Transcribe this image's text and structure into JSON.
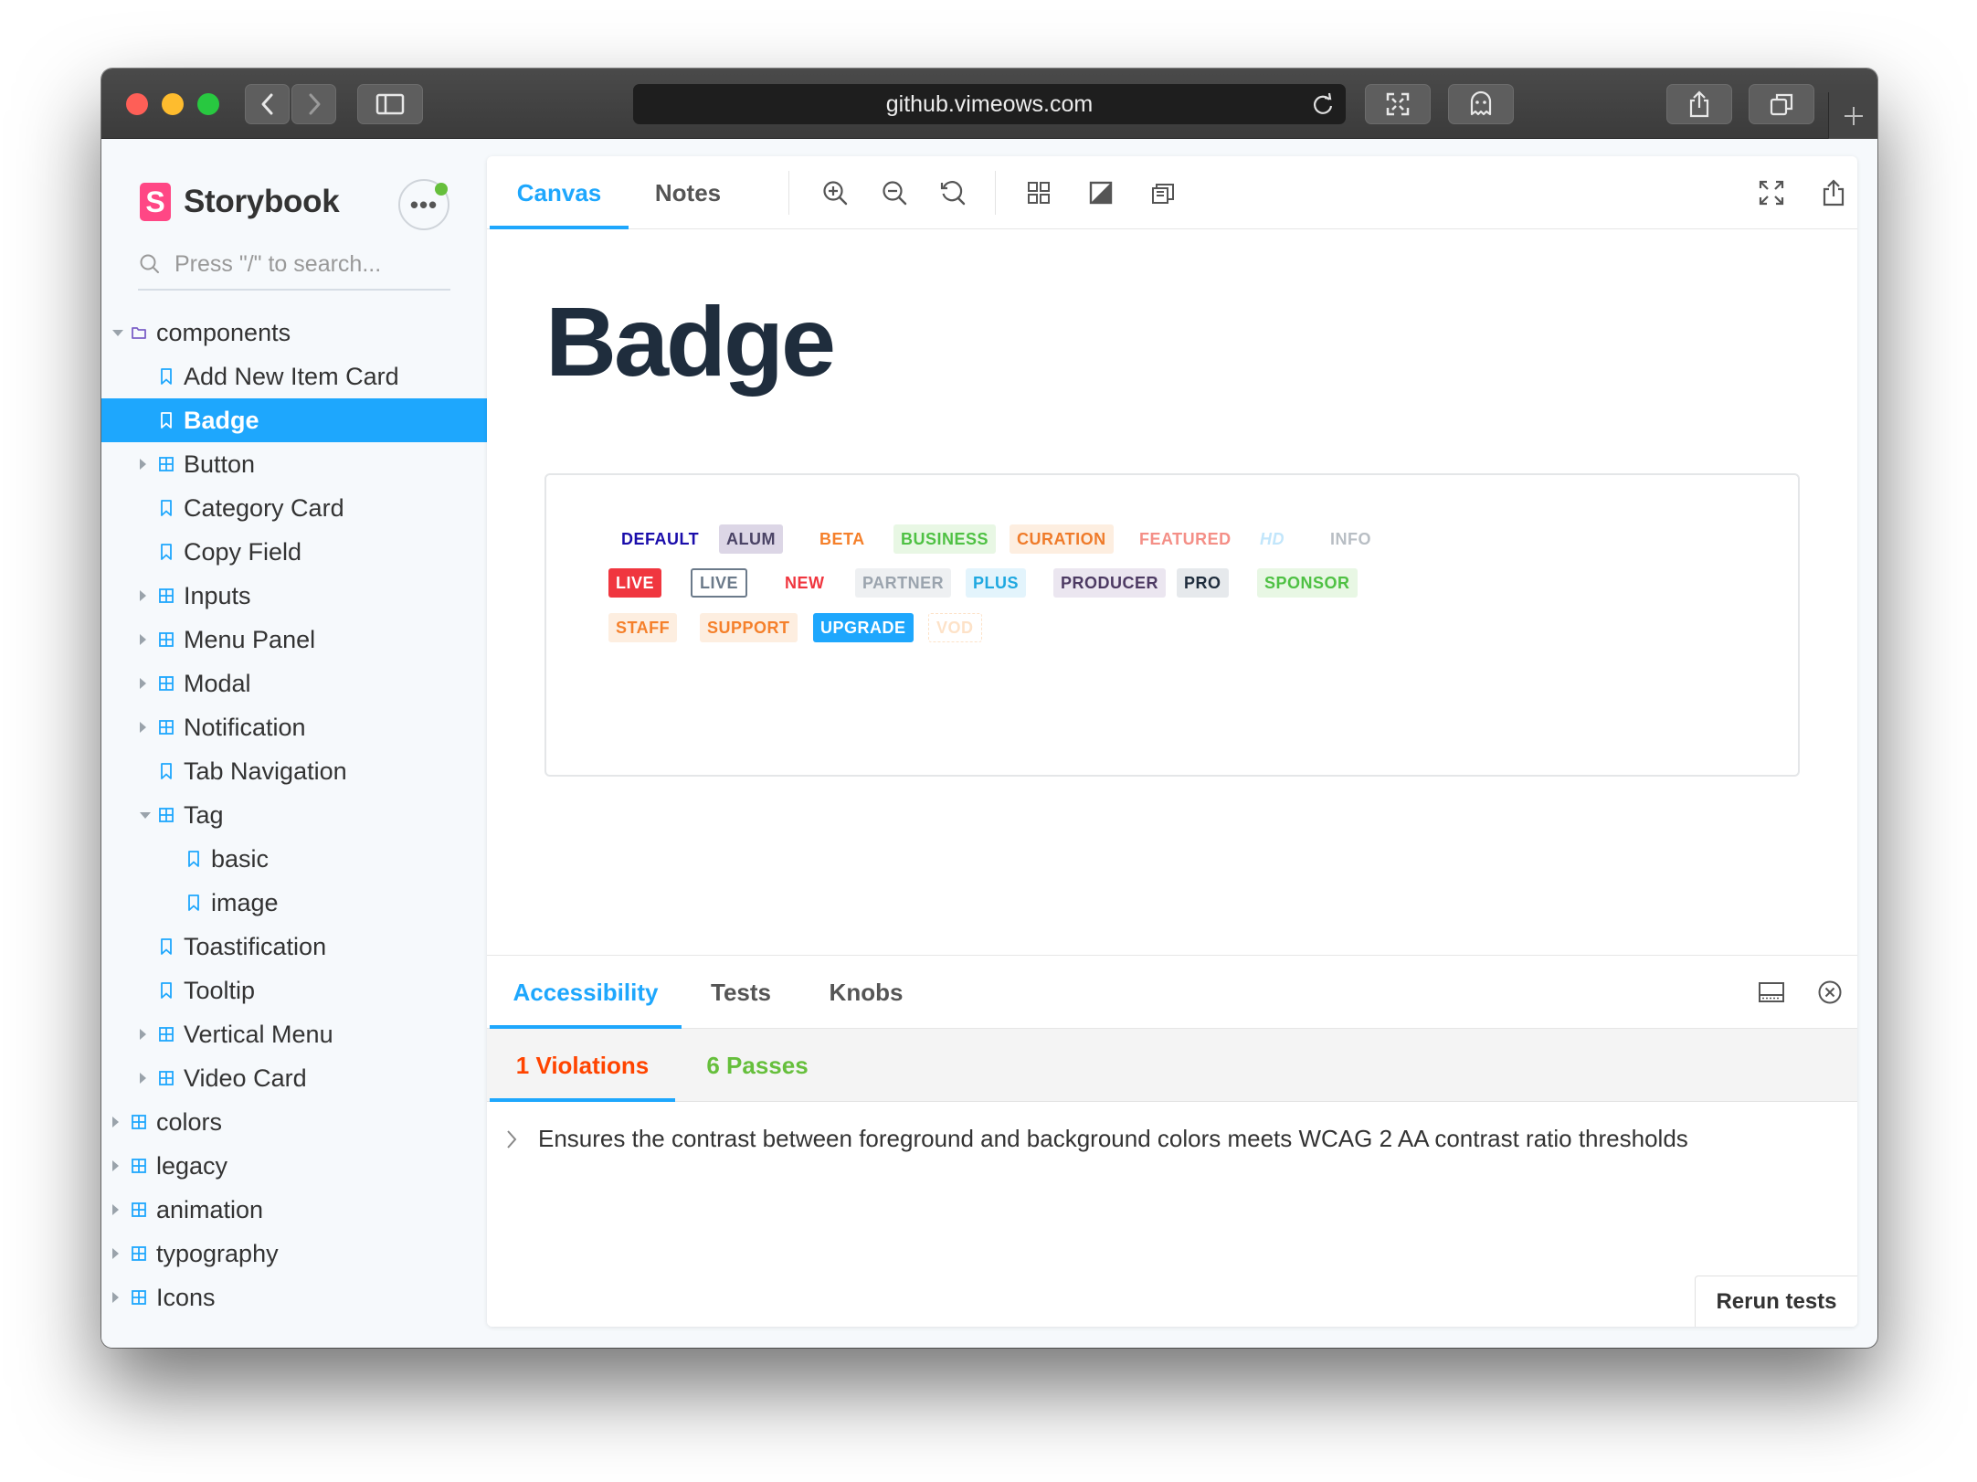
{
  "browser": {
    "url": "github.vimeows.com"
  },
  "sidebar": {
    "brand": "Storybook",
    "more_label": "•••",
    "search_placeholder": "Press \"/\" to search...",
    "tree": [
      {
        "label": "components",
        "icon": "folder-icon",
        "caret": "down",
        "level": 0
      },
      {
        "label": "Add New Item Card",
        "icon": "bookmark-icon",
        "caret": "none",
        "level": 1
      },
      {
        "label": "Badge",
        "icon": "bookmark-icon",
        "caret": "none",
        "level": 1,
        "selected": true
      },
      {
        "label": "Button",
        "icon": "grid-icon",
        "caret": "right",
        "level": 1
      },
      {
        "label": "Category Card",
        "icon": "bookmark-icon",
        "caret": "none",
        "level": 1
      },
      {
        "label": "Copy Field",
        "icon": "bookmark-icon",
        "caret": "none",
        "level": 1
      },
      {
        "label": "Inputs",
        "icon": "grid-icon",
        "caret": "right",
        "level": 1
      },
      {
        "label": "Menu Panel",
        "icon": "grid-icon",
        "caret": "right",
        "level": 1
      },
      {
        "label": "Modal",
        "icon": "grid-icon",
        "caret": "right",
        "level": 1
      },
      {
        "label": "Notification",
        "icon": "grid-icon",
        "caret": "right",
        "level": 1
      },
      {
        "label": "Tab Navigation",
        "icon": "bookmark-icon",
        "caret": "none",
        "level": 1
      },
      {
        "label": "Tag",
        "icon": "grid-icon",
        "caret": "down",
        "level": 1
      },
      {
        "label": "basic",
        "icon": "bookmark-icon",
        "caret": "none",
        "level": 2
      },
      {
        "label": "image",
        "icon": "bookmark-icon",
        "caret": "none",
        "level": 2
      },
      {
        "label": "Toastification",
        "icon": "bookmark-icon",
        "caret": "none",
        "level": 1
      },
      {
        "label": "Tooltip",
        "icon": "bookmark-icon",
        "caret": "none",
        "level": 1
      },
      {
        "label": "Vertical Menu",
        "icon": "grid-icon",
        "caret": "right",
        "level": 1
      },
      {
        "label": "Video Card",
        "icon": "grid-icon",
        "caret": "right",
        "level": 1
      },
      {
        "label": "colors",
        "icon": "grid-icon",
        "caret": "right",
        "level": 0
      },
      {
        "label": "legacy",
        "icon": "grid-icon",
        "caret": "right",
        "level": 0
      },
      {
        "label": "animation",
        "icon": "grid-icon",
        "caret": "right",
        "level": 0
      },
      {
        "label": "typography",
        "icon": "grid-icon",
        "caret": "right",
        "level": 0
      },
      {
        "label": "Icons",
        "icon": "grid-icon",
        "caret": "right",
        "level": 0
      }
    ]
  },
  "toolbar": {
    "tabs": [
      "Canvas",
      "Notes"
    ],
    "active_tab": "Canvas",
    "tools": [
      "zoom-in-icon",
      "zoom-out-icon",
      "zoom-reset-icon",
      "grid-icon",
      "background-icon",
      "viewport-icon"
    ],
    "right_tools": [
      "fullscreen-icon",
      "share-icon"
    ]
  },
  "canvas": {
    "title": "Badge",
    "badges": [
      {
        "text": "DEFAULT",
        "color": "#1a0dab",
        "bg": "transparent",
        "border": "none",
        "row": 0,
        "col": 0,
        "italic": false
      },
      {
        "text": "ALUM",
        "color": "#4b4466",
        "bg": "#dcd6e6",
        "border": "none",
        "row": 0,
        "col": 1,
        "italic": false
      },
      {
        "text": "BETA",
        "color": "#f5802b",
        "bg": "transparent",
        "border": "none",
        "row": 0,
        "col": 2,
        "italic": false
      },
      {
        "text": "BUSINESS",
        "color": "#4fc144",
        "bg": "#e8f7e4",
        "border": "none",
        "row": 0,
        "col": 3,
        "italic": false
      },
      {
        "text": "CURATION",
        "color": "#ef7b2a",
        "bg": "#fdeee0",
        "border": "none",
        "row": 0,
        "col": 4,
        "italic": false
      },
      {
        "text": "FEATURED",
        "color": "#f48f87",
        "bg": "transparent",
        "border": "none",
        "row": 0,
        "col": 5,
        "italic": false
      },
      {
        "text": "HD",
        "color": "#c2e6fb",
        "bg": "transparent",
        "border": "none",
        "row": 0,
        "col": 6,
        "italic": true
      },
      {
        "text": "INFO",
        "color": "#b8bec4",
        "bg": "transparent",
        "border": "none",
        "row": 0,
        "col": 7,
        "italic": false
      },
      {
        "text": "LIVE",
        "color": "#ffffff",
        "bg": "#f0363f",
        "border": "none",
        "row": 1,
        "col": 0,
        "italic": false
      },
      {
        "text": "LIVE",
        "color": "#6b7a8a",
        "bg": "#ffffff",
        "border": "2px solid #6b7a8a",
        "row": 1,
        "col": 1,
        "italic": false
      },
      {
        "text": "NEW",
        "color": "#f0363f",
        "bg": "transparent",
        "border": "none",
        "row": 1,
        "col": 2,
        "italic": false
      },
      {
        "text": "PARTNER",
        "color": "#9ba4ae",
        "bg": "#eef0f2",
        "border": "none",
        "row": 1,
        "col": 3,
        "italic": false
      },
      {
        "text": "PLUS",
        "color": "#1fa8e0",
        "bg": "#e3f4fc",
        "border": "none",
        "row": 1,
        "col": 4,
        "italic": false
      },
      {
        "text": "PRODUCER",
        "color": "#4d3a63",
        "bg": "#ebe6f0",
        "border": "none",
        "row": 1,
        "col": 5,
        "italic": false
      },
      {
        "text": "PRO",
        "color": "#1f2d3d",
        "bg": "#e6e9ec",
        "border": "none",
        "row": 1,
        "col": 6,
        "italic": false
      },
      {
        "text": "SPONSOR",
        "color": "#4fc144",
        "bg": "#e8f7e4",
        "border": "none",
        "row": 1,
        "col": 7,
        "italic": false
      },
      {
        "text": "STAFF",
        "color": "#f5802b",
        "bg": "#fdeee0",
        "border": "none",
        "row": 2,
        "col": 0,
        "italic": false
      },
      {
        "text": "SUPPORT",
        "color": "#f5802b",
        "bg": "#fdeee0",
        "border": "none",
        "row": 2,
        "col": 1,
        "italic": false
      },
      {
        "text": "UPGRADE",
        "color": "#ffffff",
        "bg": "#1ea7fd",
        "border": "none",
        "row": 2,
        "col": 2,
        "italic": false
      },
      {
        "text": "VOD",
        "color": "#fde2c8",
        "bg": "transparent",
        "border": "1px dashed #fde2c8",
        "row": 2,
        "col": 3,
        "italic": false
      }
    ]
  },
  "addons": {
    "tabs": [
      "Accessibility",
      "Tests",
      "Knobs"
    ],
    "active_tab": "Accessibility",
    "subtabs": {
      "violations": "1 Violations",
      "passes": "6 Passes"
    },
    "rule_text": "Ensures the contrast between foreground and background colors meets WCAG 2 AA contrast ratio thresholds",
    "rerun_label": "Rerun tests"
  },
  "colors": {
    "accent": "#1ea7fd",
    "brand": "#ff4785",
    "violation": "#ff4400",
    "pass": "#66bf3c"
  }
}
